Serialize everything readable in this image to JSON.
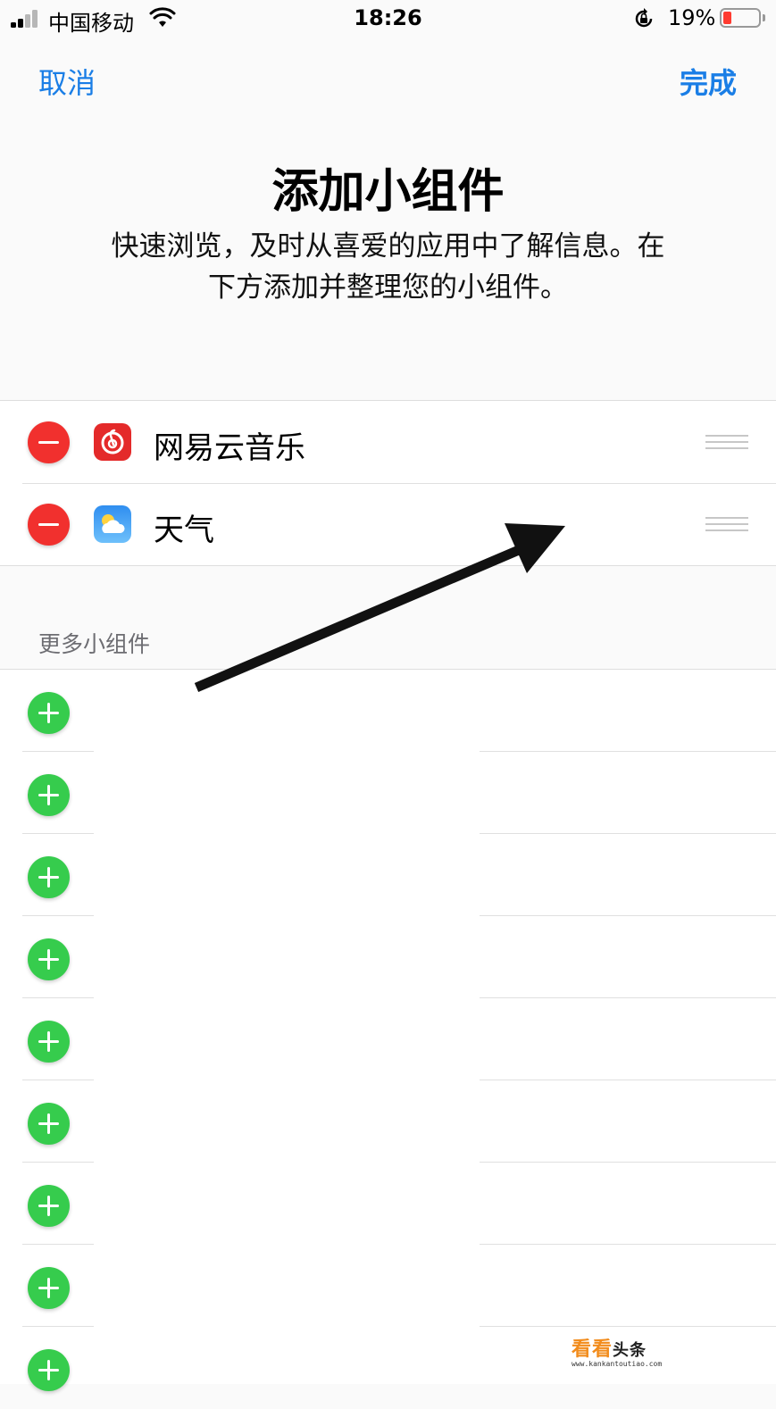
{
  "status_bar": {
    "carrier": "中国移动",
    "time": "18:26",
    "battery": "19%",
    "battery_level": 0.19,
    "battery_color": "#ff3b30"
  },
  "nav": {
    "cancel_label": "取消",
    "done_label": "完成",
    "accent_color": "#1a7ee6"
  },
  "header": {
    "title": "添加小组件",
    "subtitle_line1": "快速浏览，及时从喜爱的应用中了解信息。在",
    "subtitle_line2": "下方添加并整理您的小组件。"
  },
  "active_widgets": [
    {
      "label": "网易云音乐",
      "icon": "netease-music-icon"
    },
    {
      "label": "天气",
      "icon": "weather-icon"
    }
  ],
  "more_section": {
    "header": "更多小组件",
    "rows_visible": 9
  },
  "watermark": {
    "brand": "看看",
    "brand_suffix": "头条",
    "url": "www.kankantoutiao.com"
  }
}
